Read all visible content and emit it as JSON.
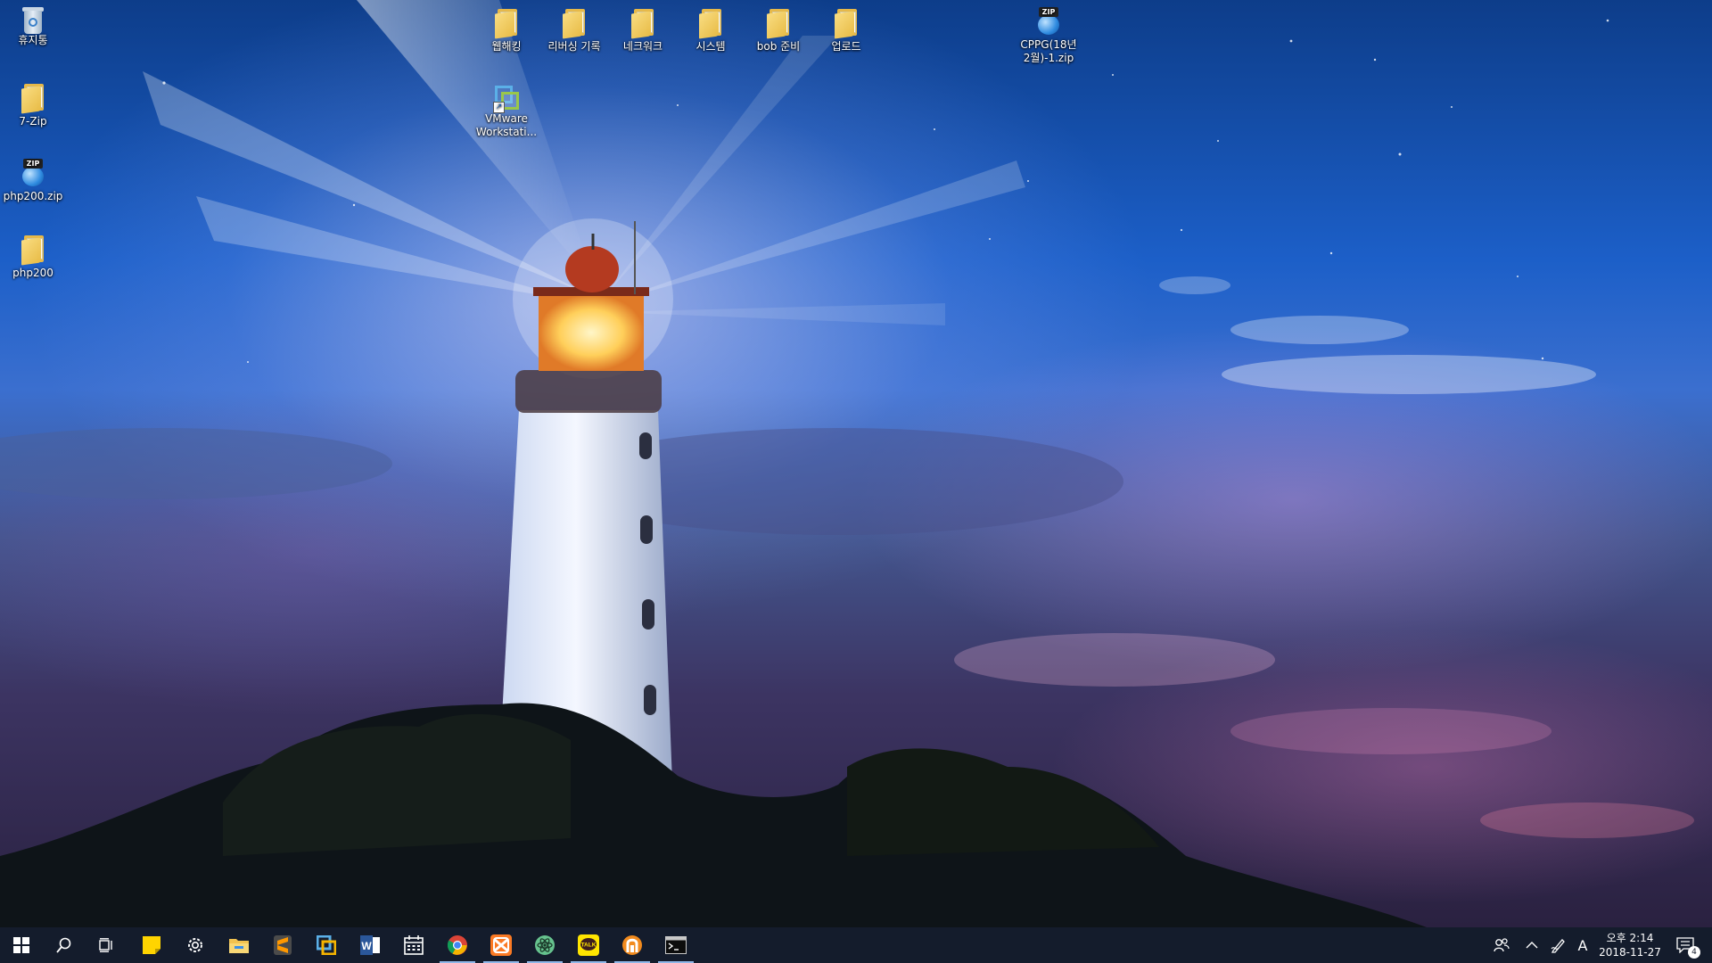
{
  "desktop": {
    "icons_left": [
      {
        "label": "휴지통",
        "icon": "recycle-bin-icon"
      },
      {
        "label": "7-Zip",
        "icon": "folder-icon"
      },
      {
        "label": "php200.zip",
        "icon": "zip-archive-icon"
      },
      {
        "label": "php200",
        "icon": "folder-icon"
      }
    ],
    "icons_top": [
      {
        "label": "웹해킹",
        "icon": "folder-icon"
      },
      {
        "label": "리버싱 기록",
        "icon": "folder-icon"
      },
      {
        "label": "네크워크",
        "icon": "folder-icon"
      },
      {
        "label": "시스템",
        "icon": "folder-icon"
      },
      {
        "label": "bob 준비",
        "icon": "folder-icon"
      },
      {
        "label": "업로드",
        "icon": "folder-icon"
      }
    ],
    "vmware": {
      "label_line1": "VMware",
      "label_line2": "Workstati...",
      "icon": "vmware-icon"
    },
    "cppg": {
      "label_line1": "CPPG(18년",
      "label_line2": "2월)-1.zip",
      "icon": "zip-archive-icon",
      "tag": "ZIP"
    },
    "zip_tag": "ZIP"
  },
  "taskbar": {
    "pinned": [
      {
        "name": "start-button",
        "icon": "windows-logo-icon"
      },
      {
        "name": "search-button",
        "icon": "search-icon"
      },
      {
        "name": "task-view-button",
        "icon": "task-view-icon"
      },
      {
        "name": "sticky-notes",
        "icon": "sticky-notes-icon"
      },
      {
        "name": "settings",
        "icon": "gear-icon"
      },
      {
        "name": "file-explorer",
        "icon": "folder-icon"
      },
      {
        "name": "sublime-text",
        "icon": "sublime-icon"
      },
      {
        "name": "vmware-workstation",
        "icon": "vmware-icon"
      },
      {
        "name": "word",
        "icon": "word-icon"
      },
      {
        "name": "calendar",
        "icon": "calendar-icon"
      },
      {
        "name": "chrome",
        "icon": "chrome-icon"
      },
      {
        "name": "xampp",
        "icon": "xampp-icon"
      },
      {
        "name": "atom",
        "icon": "atom-icon"
      },
      {
        "name": "kakaotalk",
        "icon": "kakaotalk-icon"
      },
      {
        "name": "bandizip",
        "icon": "bandizip-icon"
      },
      {
        "name": "command-prompt",
        "icon": "terminal-icon"
      }
    ],
    "kakao_label": "TALK",
    "word_letter": "W",
    "ime_letter": "A",
    "clock": {
      "period_time": "오후 2:14",
      "date": "2018-11-27"
    },
    "notification_count": "4",
    "colors": {
      "taskbar_bg": "#141c2c",
      "active_indicator": "#8fb7e8"
    }
  }
}
